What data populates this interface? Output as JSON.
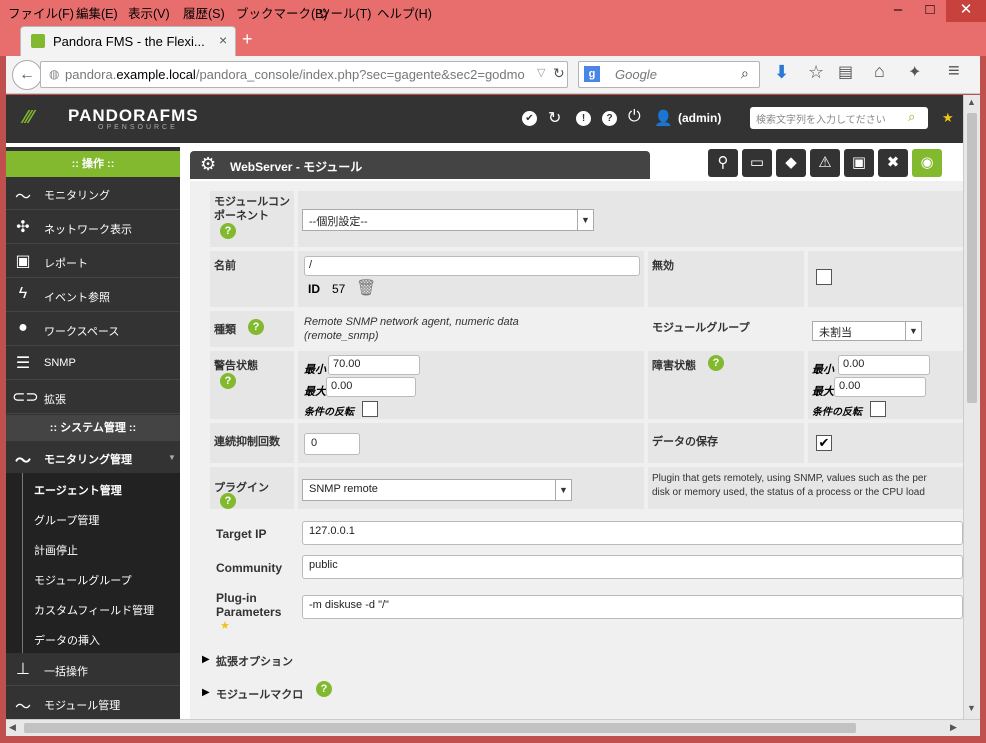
{
  "menu": [
    "ファイル(F)",
    "編集(E)",
    "表示(V)",
    "履歴(S)",
    "ブックマーク(B)",
    "ツール(T)",
    "ヘルプ(H)"
  ],
  "browser": {
    "tab_title": "Pandora FMS - the Flexi...",
    "url_prefix": "pandora.",
    "url_host": "example.local",
    "url_path": "/pandora_console/index.php?sec=gagente&sec2=godmo",
    "search_engine_placeholder": "Google"
  },
  "header": {
    "logo_text": "PANDORAFMS",
    "logo_sub": "OPENSOURCE",
    "user": "(admin)",
    "search_placeholder": "検索文字列を入力してださい"
  },
  "sidebar": {
    "section_ops": ":: 操作 ::",
    "items": [
      {
        "label": "モニタリング",
        "icon": "heartbeat-icon"
      },
      {
        "label": "ネットワーク表示",
        "icon": "network-icon"
      },
      {
        "label": "レポート",
        "icon": "report-icon"
      },
      {
        "label": "イベント参照",
        "icon": "lightning-icon"
      },
      {
        "label": "ワークスペース",
        "icon": "user-icon"
      },
      {
        "label": "SNMP",
        "icon": "list-icon"
      },
      {
        "label": "拡張",
        "icon": "plug-icon"
      }
    ],
    "section_admin": ":: システム管理 ::",
    "admin_item": "モニタリング管理",
    "sub_items": [
      "エージェント管理",
      "グループ管理",
      "計画停止",
      "モジュールグループ",
      "カスタムフィールド管理",
      "データの挿入"
    ],
    "bottom_items": [
      "一括操作",
      "モジュール管理"
    ]
  },
  "content": {
    "title": "WebServer - モジュール",
    "form": {
      "component_label": "モジュールコンポーネント",
      "component_value": "--個別設定--",
      "name_label": "名前",
      "name_value": "/",
      "id_label": "ID",
      "id_value": "57",
      "disabled_label": "無効",
      "type_label": "種類",
      "type_value_1": "Remote SNMP network agent, numeric data",
      "type_value_2": "(remote_snmp)",
      "module_group_label": "モジュールグループ",
      "module_group_value": "未割当",
      "warning_label": "警告状態",
      "min_label": "最小",
      "max_label": "最大",
      "invert_label": "条件の反転",
      "warning_min": "70.00",
      "warning_max": "0.00",
      "critical_label": "障害状態",
      "critical_min": "0.00",
      "critical_max": "0.00",
      "ff_label": "連続抑制回数",
      "ff_value": "0",
      "history_label": "データの保存",
      "plugin_label": "プラグイン",
      "plugin_value": "SNMP remote",
      "plugin_desc_1": "Plugin that gets remotely, using SNMP, values such as the per",
      "plugin_desc_2": "disk or memory used, the status of a process or the CPU load",
      "target_ip_label": "Target IP",
      "target_ip_value": "127.0.0.1",
      "community_label": "Community",
      "community_value": "public",
      "plugin_params_label_1": "Plug-in",
      "plugin_params_label_2": "Parameters",
      "plugin_params_value": "-m diskuse -d \"/\"",
      "advanced_label": "拡張オプション",
      "macros_label": "モジュールマクロ"
    }
  },
  "colors": {
    "accent": "#82b92e",
    "header_bg": "#333333",
    "window_frame": "#e86e6e"
  }
}
